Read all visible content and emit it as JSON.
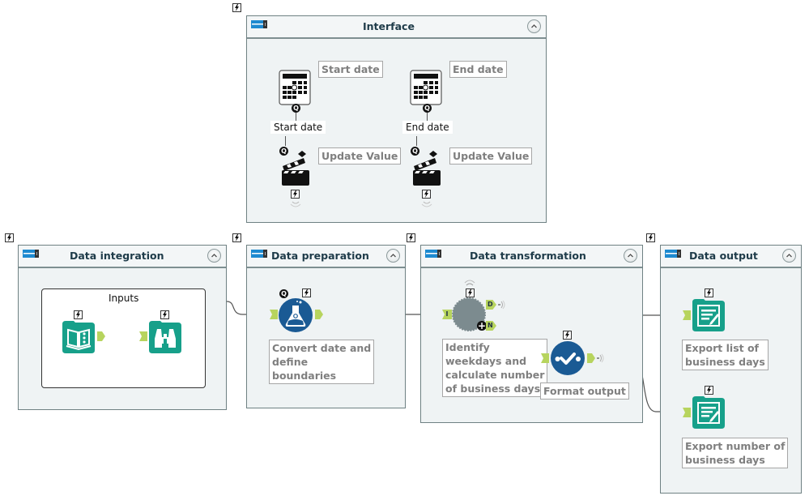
{
  "containers": {
    "interface": {
      "title": "Interface"
    },
    "data_integration": {
      "title": "Data integration"
    },
    "data_preparation": {
      "title": "Data preparation"
    },
    "data_transformation": {
      "title": "Data transformation"
    },
    "data_output": {
      "title": "Data output"
    }
  },
  "interface_tools": {
    "start_date": {
      "annotation": "Start date",
      "connection_label": "Start date",
      "action_annotation": "Update Value",
      "badge": "Q"
    },
    "end_date": {
      "annotation": "End date",
      "connection_label": "End date",
      "action_annotation": "Update Value",
      "badge": "Q"
    }
  },
  "data_integration": {
    "inputs_group_label": "Inputs"
  },
  "data_preparation": {
    "formula_annotation_lines": [
      "Convert date and",
      "define",
      "boundaries"
    ],
    "badge": "Q"
  },
  "data_transformation": {
    "macro_annotation_lines": [
      "Identify",
      "weekdays and",
      "calculate number",
      "of business days"
    ],
    "macro_input_anchor": "I",
    "macro_output_anchor_d": "D",
    "macro_output_anchor_n": "N",
    "format_annotation": "Format output"
  },
  "data_output": {
    "output1_annotation_lines": [
      "Export list of",
      "business days"
    ],
    "output2_annotation_lines": [
      "Export number of",
      "business days"
    ]
  },
  "colors": {
    "container_bg": "#eff3f4",
    "container_title": "#1e3b49",
    "teal_tool": "#17a08a",
    "blue_tool": "#1a5a94",
    "macro_gray": "#7c8b8f",
    "anchor_green": "#b7d45e",
    "annotation_text": "#7f7f7f"
  }
}
